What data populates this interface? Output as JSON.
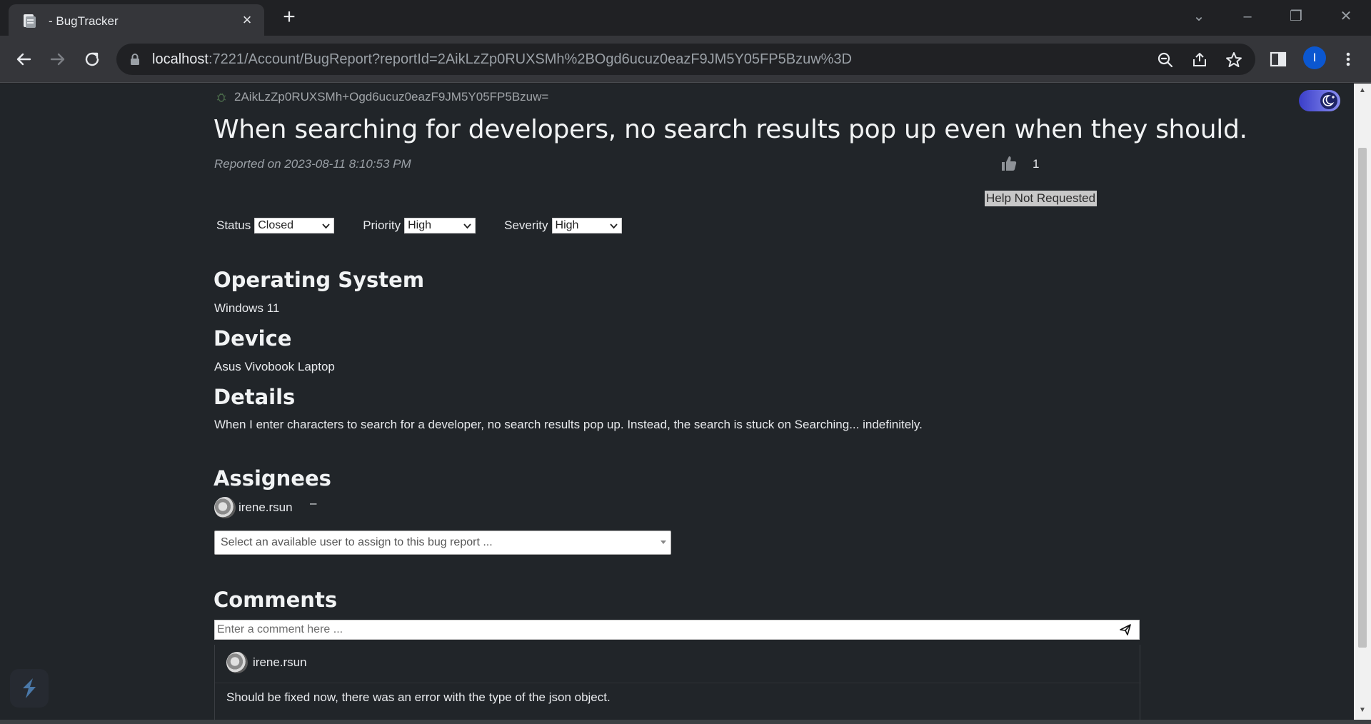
{
  "browser": {
    "tab_title": "- BugTracker",
    "url_host": "localhost",
    "url_rest": ":7221/Account/BugReport?reportId=2AikLzZp0RUXSMh%2BOgd6ucuz0eazF9JM5Y05FP5Bzuw%3D",
    "profile_initial": "I"
  },
  "report": {
    "id": "2AikLzZp0RUXSMh+Ogd6ucuz0eazF9JM5Y05FP5Bzuw=",
    "title": "When searching for developers, no search results pop up even when they should.",
    "reported_prefix": "Reported on ",
    "reported_date": "2023-08-11 8:10:53 PM",
    "votes": "1",
    "help_status": "Help Not Requested"
  },
  "fields": {
    "status_label": "Status",
    "status_value": "Closed",
    "priority_label": "Priority",
    "priority_value": "High",
    "severity_label": "Severity",
    "severity_value": "High"
  },
  "sections": {
    "os_heading": "Operating System",
    "os_value": "Windows 11",
    "device_heading": "Device",
    "device_value": "Asus Vivobook Laptop",
    "details_heading": "Details",
    "details_value": "When I enter characters to search for a developer, no search results pop up. Instead, the search is stuck on Searching... indefinitely.",
    "assignees_heading": "Assignees",
    "comments_heading": "Comments"
  },
  "assignees": {
    "items": [
      {
        "name": "irene.rsun",
        "remove_label": "–"
      }
    ],
    "select_placeholder": "Select an available user to assign to this bug report ..."
  },
  "comments": {
    "input_placeholder": "Enter a comment here ...",
    "items": [
      {
        "author": "irene.rsun",
        "body": "Should be fixed now, there was an error with the type of the json object."
      }
    ]
  },
  "colors": {
    "page_bg": "#212529",
    "chrome_bg": "#202124",
    "toolbar_bg": "#35363a",
    "toggle_accent": "#3a3ec9"
  }
}
